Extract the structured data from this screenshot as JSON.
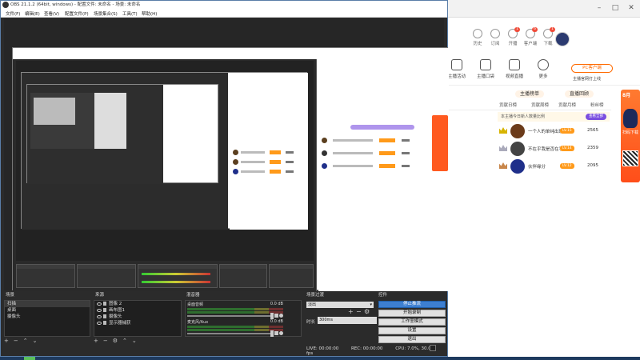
{
  "obs": {
    "title": "OBS 21.1.2 (64bit, windows) - 配置文件: 未命名 - 场景: 未命名",
    "menu": [
      "文件(F)",
      "编辑(E)",
      "查看(V)",
      "配置文件(P)",
      "场景集合(S)",
      "工具(T)",
      "帮助(H)"
    ],
    "docks": {
      "scenes": {
        "title": "场景",
        "items": [
          "扫描",
          "桌面",
          "摄像头"
        ],
        "selected_index": 0
      },
      "sources": {
        "title": "来源",
        "items": [
          "图像 2",
          "画布图1",
          "摄像头",
          "显示器捕获"
        ]
      },
      "mixer": {
        "title": "混音器",
        "channels": [
          {
            "name": "桌面音频",
            "db": "0.0 dB"
          },
          {
            "name": "麦克风/Aux",
            "db": "0.0 dB"
          }
        ]
      },
      "transitions": {
        "title": "场景过渡",
        "selected": "淡出",
        "duration_label": "时长",
        "duration_value": "300ms"
      },
      "controls": {
        "title": "控件",
        "buttons": [
          "停止推流",
          "开始录制",
          "工作室模式",
          "设置",
          "退出"
        ]
      }
    },
    "statusbar": {
      "live": "LIVE: 00:00:00",
      "rec": "REC: 00:00:00",
      "cpu": "CPU: 7.0%, 30.00 fps"
    }
  },
  "browser": {
    "nav": [
      {
        "label": "历史",
        "badge": ""
      },
      {
        "label": "订阅",
        "badge": ""
      },
      {
        "label": "开播",
        "badge": "1"
      },
      {
        "label": "客户端",
        "badge": "6"
      },
      {
        "label": "下载",
        "badge": "1"
      }
    ],
    "actions": [
      "主播活动",
      "主播口袋",
      "视频直播",
      "更多"
    ],
    "pc_button": "PC客户端",
    "pc_sub": "主播官网打上线",
    "section_left": "主播榜单",
    "section_right": "直播回顾",
    "tabs": [
      "贡献日榜",
      "贡献周榜",
      "贡献月榜",
      "粉丝榜"
    ],
    "hint_text": "本主播今日新人数量比例",
    "hint_pill": "查看全部",
    "rankings": [
      {
        "name": "一个人的单纯出现",
        "level": "LV.15",
        "score": "2565"
      },
      {
        "name": "不在乎我是否在乎",
        "level": "LV.14",
        "score": "2359"
      },
      {
        "name": "伙伴缘分",
        "level": "LV.12",
        "score": "2095"
      }
    ],
    "banner_text": "8月",
    "banner_sub": "扫码下载",
    "colors": {
      "accent": "#ff6a00",
      "purple": "#7a4ee0",
      "level": "#ff9a1a"
    }
  }
}
